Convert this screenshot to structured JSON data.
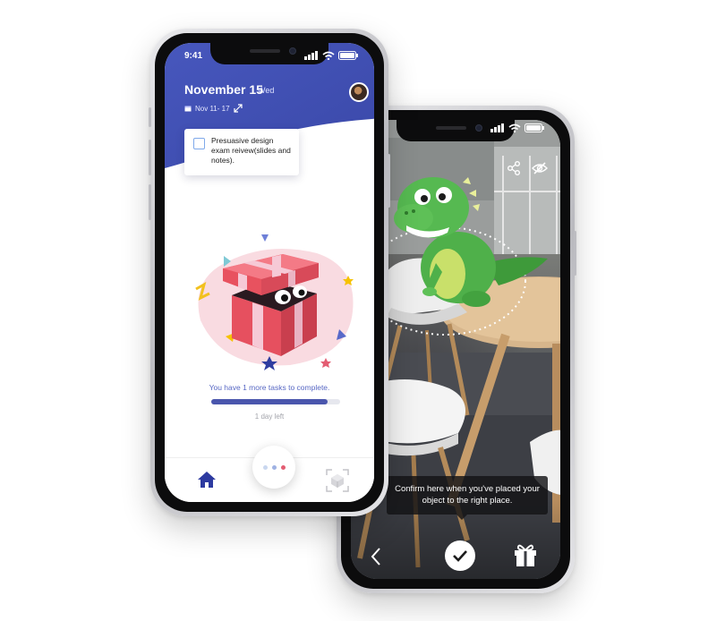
{
  "phone1": {
    "status_time": "9:41",
    "date_title": "November 15",
    "date_day": "Wed",
    "date_range": "Nov 11- 17",
    "task_text": "Presuasive design exam reivew(slides and notes).",
    "progress_text": "You have 1 more tasks to complete.",
    "progress_fraction": 0.9,
    "days_left": "1 day left",
    "fab_dot_colors": [
      "#c9d7ef",
      "#9fb2e3",
      "#e35d72"
    ],
    "tabs": [
      {
        "icon": "home-icon",
        "active": true
      },
      {
        "icon": "ar-cube-icon",
        "active": false
      }
    ]
  },
  "phone2": {
    "confirm_tip": "Confirm here when you've placed your object to the right place.",
    "icons": [
      "share-icon",
      "hide-icon",
      "back-chevron-icon",
      "checkmark-icon",
      "gift-icon"
    ]
  },
  "colors": {
    "brand_blue": "#4555b8",
    "progress_fill": "#4a56ad",
    "progress_text": "#5868c4",
    "box_red": "#e6505f",
    "ribbon_pink": "#f6c9d6",
    "blob_pink": "#f9dbe1",
    "dino_green": "#4fb04a"
  }
}
